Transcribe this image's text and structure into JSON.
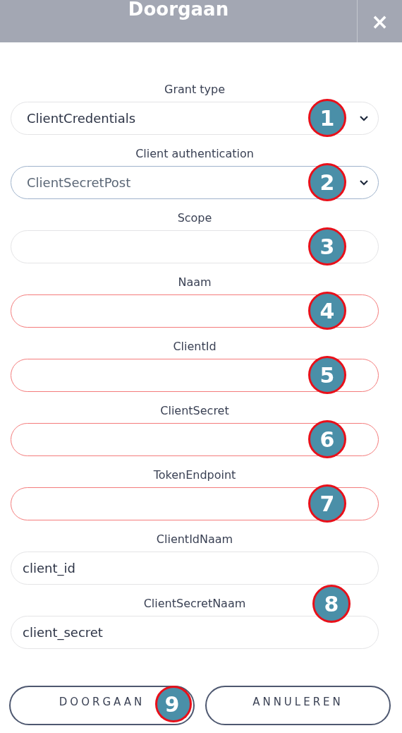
{
  "dialog": {
    "title": "Doorgaan",
    "close": "×"
  },
  "fields": [
    {
      "label": "Grant type",
      "kind": "select",
      "value": "ClientCredentials",
      "invalid": false,
      "focused": false,
      "callout": "1"
    },
    {
      "label": "Client authentication",
      "kind": "select",
      "value": "ClientSecretPost",
      "invalid": false,
      "focused": true,
      "callout": "2"
    },
    {
      "label": "Scope",
      "kind": "text",
      "invalid": false,
      "focused": false,
      "callout": "3"
    },
    {
      "label": "Naam",
      "kind": "text",
      "invalid": true,
      "focused": false,
      "callout": "4"
    },
    {
      "label": "ClientId",
      "kind": "text",
      "invalid": true,
      "focused": false,
      "callout": "5"
    },
    {
      "label": "ClientSecret",
      "kind": "text",
      "invalid": true,
      "focused": false,
      "callout": "6"
    },
    {
      "label": "TokenEndpoint",
      "kind": "text",
      "invalid": true,
      "focused": false,
      "callout": "7"
    },
    {
      "label": "ClientIdNaam",
      "kind": "text",
      "value": "client_id",
      "invalid": false,
      "focused": false
    },
    {
      "label": "ClientSecretNaam",
      "kind": "text",
      "value": "client_secret",
      "invalid": false,
      "focused": false,
      "label_callout": "8"
    }
  ],
  "buttons": [
    {
      "label": "DOORGAAN",
      "callout": "9"
    },
    {
      "label": "ANNULEREN"
    }
  ]
}
